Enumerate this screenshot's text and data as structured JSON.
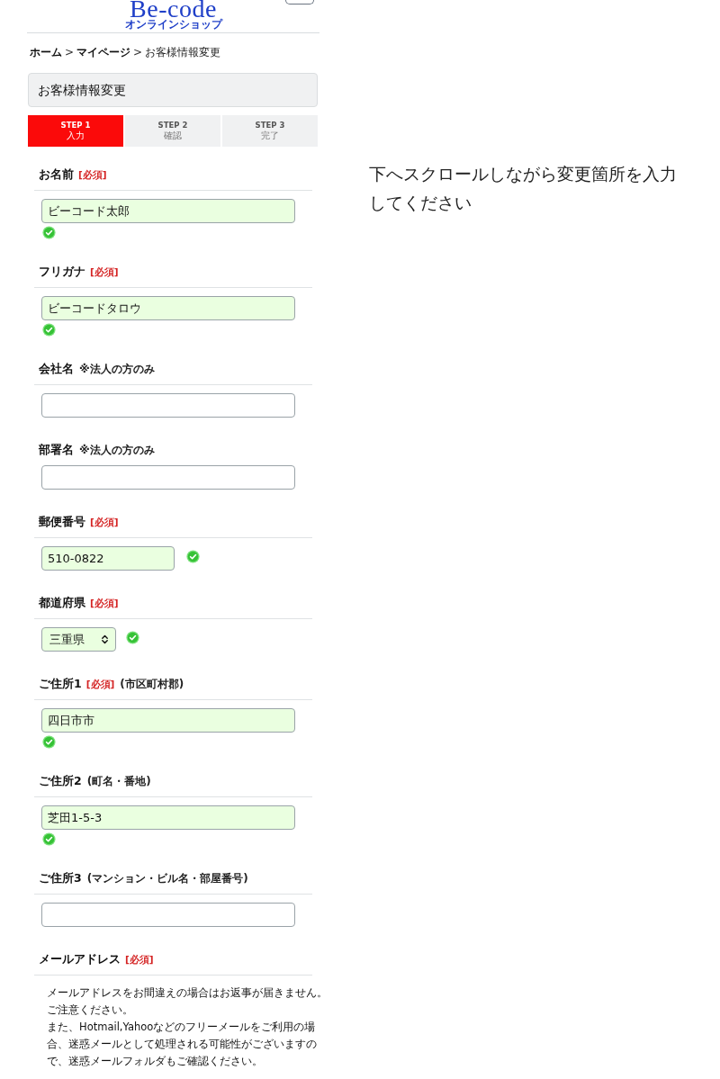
{
  "header": {
    "logo": "Be-code",
    "logo_sub": "オンラインショップ"
  },
  "breadcrumb": {
    "separator": ">",
    "items": [
      {
        "label": "ホーム",
        "current": false
      },
      {
        "label": "マイページ",
        "current": false
      },
      {
        "label": "お客様情報変更",
        "current": true
      }
    ]
  },
  "page_title": "お客様情報変更",
  "steps": [
    {
      "label": "STEP 1",
      "sub": "入力",
      "selected": true
    },
    {
      "label": "STEP 2",
      "sub": "確認",
      "selected": false
    },
    {
      "label": "STEP 3",
      "sub": "完了",
      "selected": false
    }
  ],
  "fields": [
    {
      "kind": "text",
      "label": "お名前",
      "required_mark": "[必須]",
      "divider": true,
      "value": "ビーコード太郎",
      "valid": true
    },
    {
      "kind": "text",
      "label": "フリガナ",
      "required_mark": "[必須]",
      "divider": true,
      "value": "ビーコードタロウ",
      "valid": true
    },
    {
      "kind": "text",
      "label": "会社名",
      "note": "※法人の方のみ",
      "divider": true,
      "valid": false
    },
    {
      "kind": "text",
      "label": "部署名",
      "note": "※法人の方のみ",
      "divider": false,
      "valid": false
    },
    {
      "kind": "short",
      "label": "郵便番号",
      "required_mark": "[必須]",
      "divider": true,
      "value": "510-0822",
      "valid": true
    },
    {
      "kind": "select",
      "label": "都道府県",
      "required_mark": "[必須]",
      "divider": true,
      "value": "三重県",
      "valid": true
    },
    {
      "kind": "text",
      "label": "ご住所1",
      "required_mark": "[必須]",
      "note": "(市区町村郡)",
      "divider": true,
      "value": "四日市市",
      "valid": true
    },
    {
      "kind": "text",
      "label": "ご住所2",
      "note": "(町名・番地)",
      "divider": true,
      "value": "芝田1-5-3",
      "valid": true
    },
    {
      "kind": "text",
      "label": "ご住所3",
      "note": "(マンション・ビル名・部屋番号)",
      "divider": true,
      "valid": false
    },
    {
      "kind": "notice",
      "label": "メールアドレス",
      "required_mark": "[必須]",
      "divider": true,
      "notice": [
        "メールアドレスをお間違えの場合はお返事が届きません。",
        "ご注意ください。",
        "また、Hotmail,Yahooなどのフリーメールをご利用の場合、迷惑メールとして処理される可能性がございますので、迷惑メールフォルダもご確認ください。"
      ]
    }
  ],
  "side_note": "下へスクロールしながら変更箇所を入力してください"
}
